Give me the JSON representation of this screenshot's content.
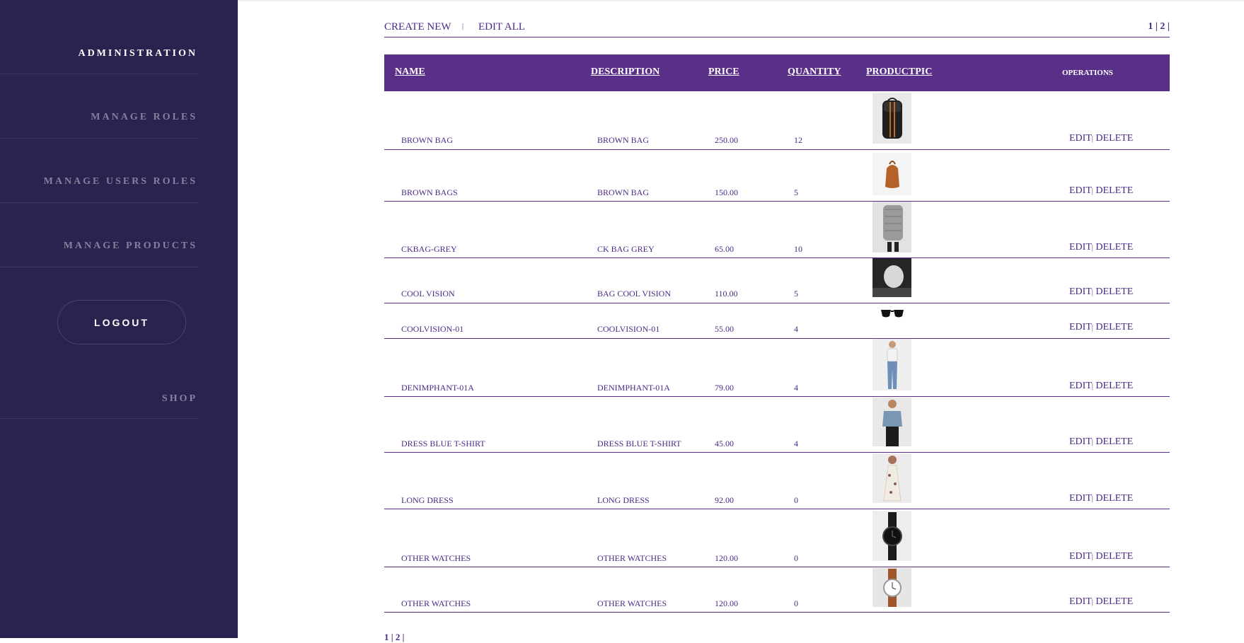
{
  "sidebar": {
    "administration": "ADMINISTRATION",
    "manage_roles": "MANAGE ROLES",
    "manage_users_roles": "MANAGE USERS ROLES",
    "manage_products": "MANAGE PRODUCTS",
    "logout": "LOGOUT",
    "shop": "SHOP"
  },
  "toolbar": {
    "create_new": "CREATE NEW",
    "separator": "|",
    "edit_all": "EDIT ALL",
    "pager": "1 | 2 |"
  },
  "table": {
    "headers": {
      "name": "NAME",
      "description": "DESCRIPTION",
      "price": "PRICE",
      "quantity": "QUANTITY",
      "productpic": "PRODUCTPIC",
      "operations": "OPERATIONS"
    },
    "edit_label": "EDIT",
    "ops_separator": "|",
    "delete_label": "DELETE",
    "rows": [
      {
        "name": "BROWN BAG",
        "description": "BROWN BAG",
        "price": "250.00",
        "quantity": "12",
        "pic": "black-backpack"
      },
      {
        "name": "BROWN BAGS",
        "description": "BROWN BAG",
        "price": "150.00",
        "quantity": "5",
        "pic": "brown-bucket-bag"
      },
      {
        "name": "CKBAG-GREY",
        "description": "CK BAG GREY",
        "price": "65.00",
        "quantity": "10",
        "pic": "grey-backpack"
      },
      {
        "name": "COOL VISION",
        "description": "BAG COOL VISION",
        "price": "110.00",
        "quantity": "5",
        "pic": "bag-photo"
      },
      {
        "name": "COOLVISION-01",
        "description": "COOLVISION-01",
        "price": "55.00",
        "quantity": "4",
        "pic": "sunglasses"
      },
      {
        "name": "DENIMPHANT-01A",
        "description": "DENIMPHANT-01A",
        "price": "79.00",
        "quantity": "4",
        "pic": "denim-pants-model"
      },
      {
        "name": "DRESS BLUE T-SHIRT",
        "description": "DRESS BLUE T-SHIRT",
        "price": "45.00",
        "quantity": "4",
        "pic": "blue-tshirt-model"
      },
      {
        "name": "LONG DRESS",
        "description": "LONG DRESS",
        "price": "92.00",
        "quantity": "0",
        "pic": "long-dress-model"
      },
      {
        "name": "OTHER WATCHES",
        "description": "OTHER WATCHES",
        "price": "120.00",
        "quantity": "0",
        "pic": "black-watch"
      },
      {
        "name": "OTHER WATCHES",
        "description": "OTHER WATCHES",
        "price": "120.00",
        "quantity": "0",
        "pic": "brown-strap-watch"
      }
    ]
  },
  "pager_bottom": "1 | 2 |"
}
